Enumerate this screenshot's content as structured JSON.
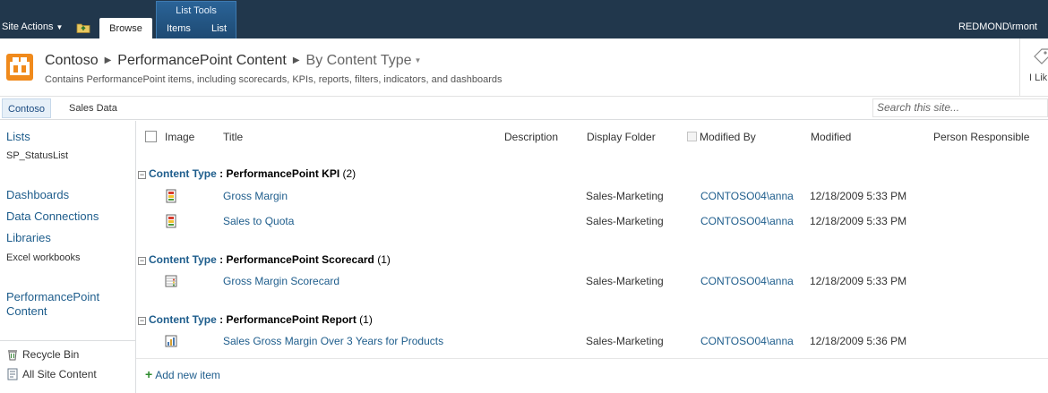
{
  "ribbon": {
    "site_actions": "Site Actions",
    "browse_tab": "Browse",
    "list_tools_title": "List Tools",
    "items_tab": "Items",
    "list_tab": "List",
    "user": "REDMOND\\rmont"
  },
  "header": {
    "breadcrumb_site": "Contoso",
    "breadcrumb_list": "PerformancePoint Content",
    "breadcrumb_view": "By Content Type",
    "description": "Contains PerformancePoint items, including scorecards, KPIs, reports, filters, indicators, and dashboards",
    "like_label": "I Lik"
  },
  "top_links": {
    "items": [
      "Contoso",
      "Sales Data"
    ],
    "search_placeholder": "Search this site..."
  },
  "quick_launch": {
    "lists_heading": "Lists",
    "lists_items": [
      "SP_StatusList"
    ],
    "dashboards": "Dashboards",
    "data_connections": "Data Connections",
    "libraries": "Libraries",
    "libraries_items": [
      "Excel workbooks"
    ],
    "pp_content_line1": "PerformancePoint",
    "pp_content_line2": "Content",
    "recycle_bin": "Recycle Bin",
    "all_site_content": "All Site Content"
  },
  "list": {
    "columns": {
      "image": "Image",
      "title": "Title",
      "description": "Description",
      "display_folder": "Display Folder",
      "modified_by": "Modified By",
      "modified": "Modified",
      "person_responsible": "Person Responsible"
    },
    "group_key": "Content Type",
    "group_colon": " :",
    "groups": [
      {
        "name": "PerformancePoint KPI",
        "count": "(2)",
        "items": [
          {
            "icon": "kpi-icon",
            "title": "Gross Margin",
            "folder": "Sales-Marketing",
            "modified_by": "CONTOSO04\\anna",
            "modified": "12/18/2009 5:33 PM"
          },
          {
            "icon": "kpi-icon",
            "title": "Sales to Quota",
            "folder": "Sales-Marketing",
            "modified_by": "CONTOSO04\\anna",
            "modified": "12/18/2009 5:33 PM"
          }
        ]
      },
      {
        "name": "PerformancePoint Scorecard",
        "count": "(1)",
        "items": [
          {
            "icon": "scorecard-icon",
            "title": "Gross Margin Scorecard",
            "folder": "Sales-Marketing",
            "modified_by": "CONTOSO04\\anna",
            "modified": "12/18/2009 5:33 PM"
          }
        ]
      },
      {
        "name": "PerformancePoint Report",
        "count": "(1)",
        "items": [
          {
            "icon": "report-icon",
            "title": "Sales Gross Margin Over 3 Years for Products",
            "folder": "Sales-Marketing",
            "modified_by": "CONTOSO04\\anna",
            "modified": "12/18/2009 5:36 PM"
          }
        ]
      }
    ],
    "add_new_item": "Add new item"
  },
  "colors": {
    "ribbon_bg": "#21374c",
    "link": "#1e5d8c",
    "list_tools_bg": "#2a6397"
  }
}
